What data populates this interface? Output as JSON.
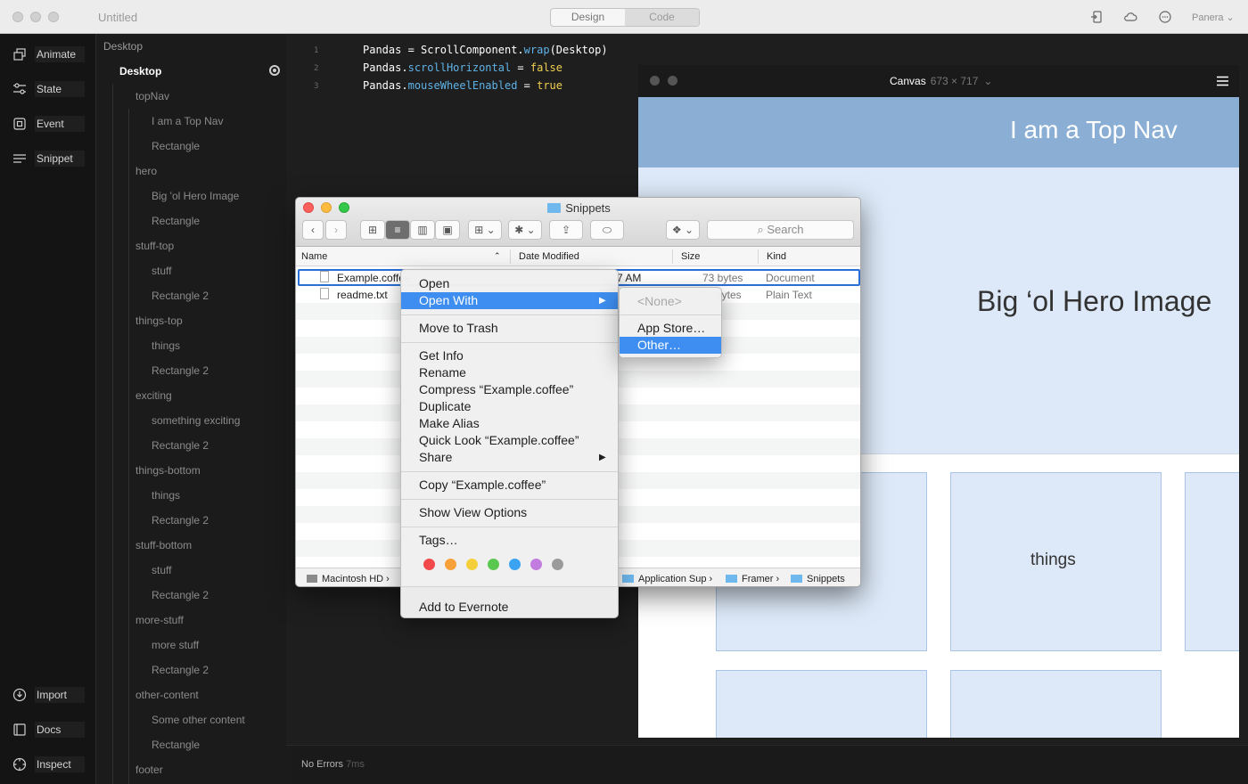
{
  "app": {
    "title": "Untitled",
    "mode_tabs": [
      "Design",
      "Code"
    ],
    "user": "Panera"
  },
  "toolbar": {
    "top_tools": [
      {
        "label": "Animate",
        "icon": "animate-icon"
      },
      {
        "label": "State",
        "icon": "sliders-icon"
      },
      {
        "label": "Event",
        "icon": "event-icon"
      },
      {
        "label": "Snippet",
        "icon": "snippet-icon"
      }
    ],
    "bottom_tools": [
      {
        "label": "Import",
        "icon": "import-icon"
      },
      {
        "label": "Docs",
        "icon": "docs-icon"
      },
      {
        "label": "Inspect",
        "icon": "inspect-icon"
      }
    ]
  },
  "layers": {
    "root": "Desktop",
    "selected": "Desktop",
    "items": [
      "topNav",
      "I am a Top Nav",
      "Rectangle",
      "hero",
      "Big 'ol Hero Image",
      "Rectangle",
      "stuff-top",
      "stuff",
      "Rectangle 2",
      "things-top",
      "things",
      "Rectangle 2",
      "exciting",
      "something exciting",
      "Rectangle 2",
      "things-bottom",
      "things",
      "Rectangle 2",
      "stuff-bottom",
      "stuff",
      "Rectangle 2",
      "more-stuff",
      "more stuff",
      "Rectangle 2",
      "other-content",
      "Some other content",
      "Rectangle",
      "footer"
    ]
  },
  "editor": {
    "line_numbers": [
      "1",
      "2",
      "3"
    ],
    "lines": [
      {
        "tokens": [
          [
            "Pandas",
            "#ffffff"
          ],
          [
            " = ",
            "#ffffff"
          ],
          [
            "ScrollComponent",
            "#ffffff"
          ],
          [
            ".",
            "#ffffff"
          ],
          [
            "wrap",
            "#5fb3e8"
          ],
          [
            "(Desktop)",
            "#ffffff"
          ]
        ]
      },
      {
        "tokens": [
          [
            "Pandas",
            "#ffffff"
          ],
          [
            ".",
            "#ffffff"
          ],
          [
            "scrollHorizontal",
            "#5fb3e8"
          ],
          [
            " = ",
            "#ffffff"
          ],
          [
            "false",
            "#f0d050"
          ]
        ]
      },
      {
        "tokens": [
          [
            "Pandas",
            "#ffffff"
          ],
          [
            ".",
            "#ffffff"
          ],
          [
            "mouseWheelEnabled",
            "#5fb3e8"
          ],
          [
            " = ",
            "#ffffff"
          ],
          [
            "true",
            "#f0d050"
          ]
        ]
      }
    ],
    "status": "No Errors",
    "status_time": "7ms"
  },
  "canvas": {
    "title": "Canvas",
    "dimensions": "673 × 717",
    "topnav_text": "I am a Top Nav",
    "hero_text": "Big ‘ol Hero Image",
    "things_text": "things"
  },
  "finder": {
    "title": "Snippets",
    "search_placeholder": "Search",
    "columns": [
      "Name",
      "Date Modified",
      "Size",
      "Kind"
    ],
    "files": [
      {
        "name": "Example.coffee",
        "date": "7 AM",
        "size": "73 bytes",
        "kind": "Document"
      },
      {
        "name": "readme.txt",
        "date": "",
        "size": "bytes",
        "kind": "Plain Text"
      }
    ],
    "path": [
      "Macintosh HD",
      "Application Sup",
      "Framer",
      "Snippets"
    ]
  },
  "context_menu": {
    "items": [
      "Open",
      "Open With",
      "Move to Trash",
      "Get Info",
      "Rename",
      "Compress “Example.coffee”",
      "Duplicate",
      "Make Alias",
      "Quick Look “Example.coffee”",
      "Share",
      "Copy “Example.coffee”",
      "Show View Options",
      "Tags…",
      "Add to Evernote"
    ],
    "highlighted": "Open With",
    "tag_colors": [
      "#f24a4a",
      "#f7a03a",
      "#f4cf3a",
      "#5ac84f",
      "#3aa3f2",
      "#c27bdf",
      "#9b9b9b"
    ]
  },
  "submenu": {
    "items": [
      "<None>",
      "App Store…",
      "Other…"
    ],
    "highlighted": "Other…"
  }
}
